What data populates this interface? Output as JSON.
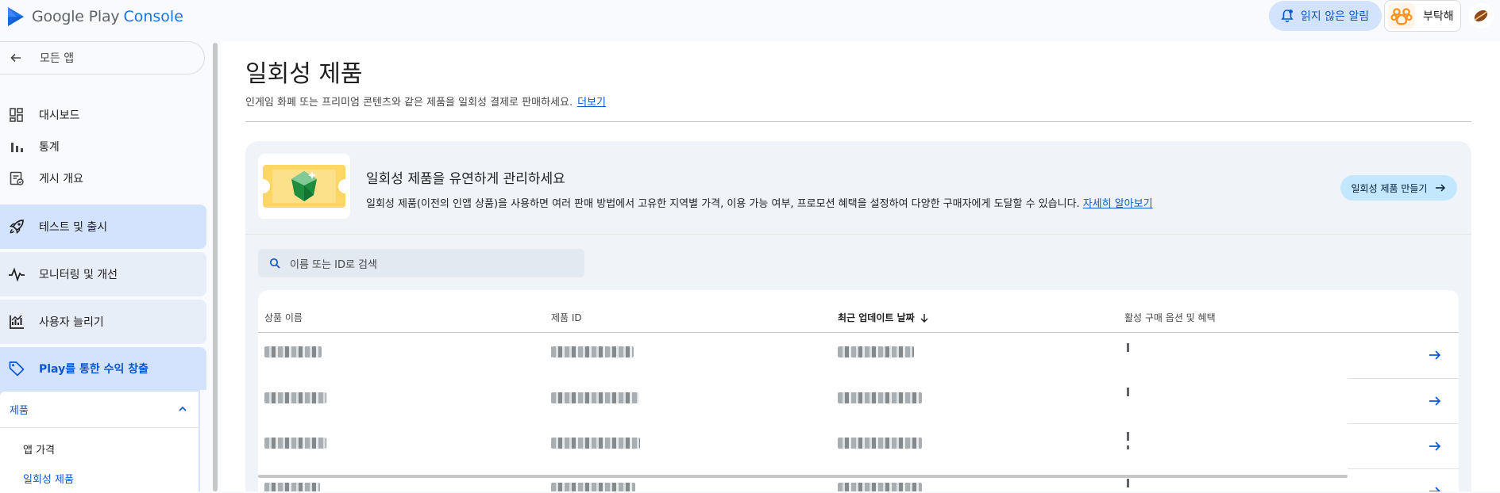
{
  "topbar": {
    "logo_google": "Google Play",
    "logo_console": "Console",
    "notifications_label": "읽지 않은 알림",
    "profile_name": "부탁해"
  },
  "sidebar": {
    "back_label": "모든 앱",
    "items": [
      {
        "label": "대시보드",
        "icon": "dashboard-icon"
      },
      {
        "label": "통계",
        "icon": "bar-chart-icon"
      },
      {
        "label": "게시 개요",
        "icon": "publishing-overview-icon"
      }
    ],
    "blocks": [
      {
        "label": "테스트 및 출시",
        "icon": "rocket-icon"
      },
      {
        "label": "모니터링 및 개선",
        "icon": "vitals-icon"
      },
      {
        "label": "사용자 늘리기",
        "icon": "grow-users-icon"
      },
      {
        "label": "Play를 통한 수익 창출",
        "icon": "tag-icon"
      }
    ],
    "products_section": {
      "label": "제품",
      "items": [
        {
          "label": "앱 가격",
          "active": false
        },
        {
          "label": "일회성 제품",
          "active": true
        }
      ]
    }
  },
  "page": {
    "title": "일회성 제품",
    "description": "인게임 화폐 또는 프리미엄 콘텐츠와 같은 제품을 일회성 결제로 판매하세요.",
    "more_link": "더보기"
  },
  "promo": {
    "title": "일회성 제품을 유연하게 관리하세요",
    "text": "일회성 제품(이전의 인앱 상품)을 사용하면 여러 판매 방법에서 고유한 지역별 가격, 이용 가능 여부, 프로모션 혜택을 설정하여 다양한 구매자에게 도달할 수 있습니다.",
    "learn_more": "자세히 알아보기",
    "create_button": "일회성 제품 만들기"
  },
  "search": {
    "placeholder": "이름 또는 ID로 검색"
  },
  "table": {
    "columns": [
      "상품 이름",
      "제품 ID",
      "최근 업데이트 날짜",
      "활성 구매 옵션 및 혜택"
    ],
    "sorted_column": "최근 업데이트 날짜",
    "sort_direction": "descending"
  },
  "colors": {
    "accent": "#0b57d0",
    "chip_bg": "#d3e3fd",
    "card_bg": "#f0f4f9"
  }
}
